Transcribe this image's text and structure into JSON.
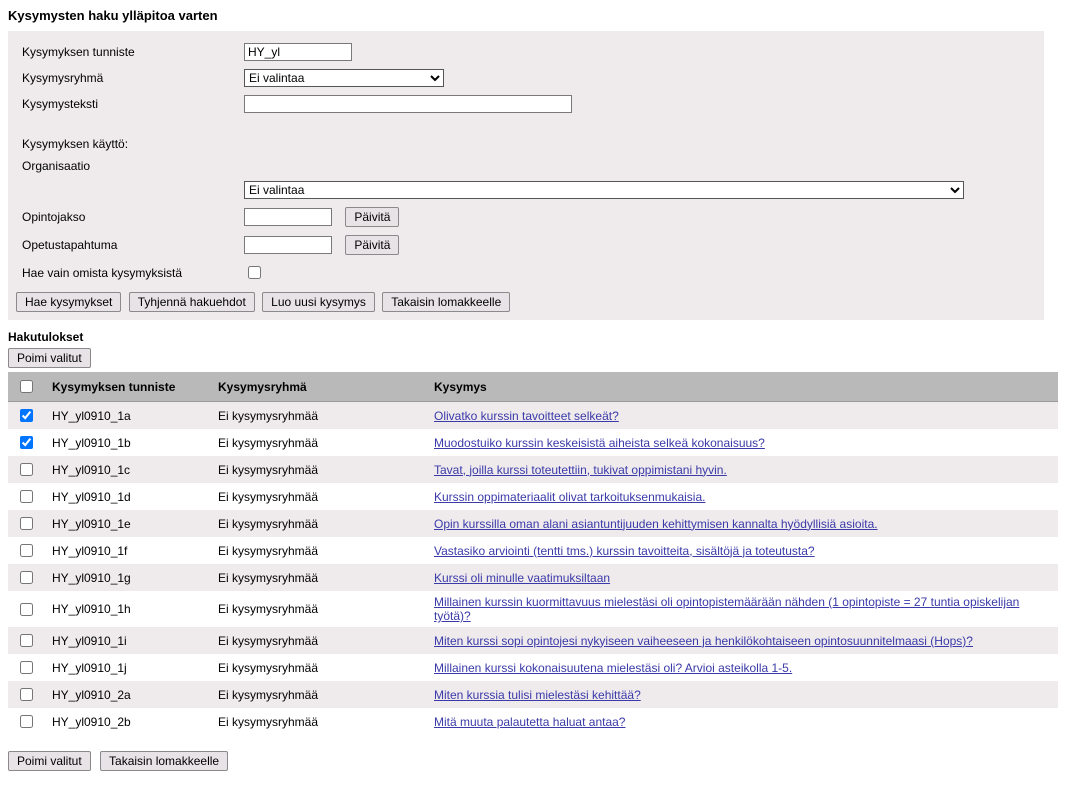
{
  "titles": {
    "page": "Kysymysten haku ylläpitoa varten",
    "results": "Hakutulokset"
  },
  "form": {
    "labels": {
      "id": "Kysymyksen tunniste",
      "group": "Kysymysryhmä",
      "text": "Kysymysteksti",
      "usage": "Kysymyksen käyttö:",
      "org": "Organisaatio",
      "course": "Opintojakso",
      "event": "Opetustapahtuma",
      "owncb": "Hae vain omista kysymyksistä"
    },
    "values": {
      "id": "HY_yl",
      "group": "Ei valintaa",
      "text": "",
      "org": "Ei valintaa",
      "course": "",
      "event": ""
    },
    "buttons": {
      "update": "Päivitä",
      "search": "Hae kysymykset",
      "clear": "Tyhjennä hakuehdot",
      "create": "Luo uusi kysymys",
      "backform": "Takaisin lomakkeelle",
      "pick": "Poimi valitut"
    }
  },
  "headers": {
    "id": "Kysymyksen tunniste",
    "group": "Kysymysryhmä",
    "question": "Kysymys"
  },
  "rows": [
    {
      "checked": true,
      "id": "HY_yl0910_1a",
      "group": "Ei kysymysryhmää",
      "question": "Olivatko kurssin tavoitteet selkeät?"
    },
    {
      "checked": true,
      "id": "HY_yl0910_1b",
      "group": "Ei kysymysryhmää",
      "question": "Muodostuiko kurssin keskeisistä aiheista selkeä kokonaisuus?"
    },
    {
      "checked": false,
      "id": "HY_yl0910_1c",
      "group": "Ei kysymysryhmää",
      "question": "Tavat, joilla kurssi toteutettiin, tukivat oppimistani hyvin."
    },
    {
      "checked": false,
      "id": "HY_yl0910_1d",
      "group": "Ei kysymysryhmää",
      "question": "Kurssin oppimateriaalit olivat tarkoituksenmukaisia."
    },
    {
      "checked": false,
      "id": "HY_yl0910_1e",
      "group": "Ei kysymysryhmää",
      "question": "Opin kurssilla oman alani asiantuntijuuden kehittymisen kannalta hyödyllisiä asioita."
    },
    {
      "checked": false,
      "id": "HY_yl0910_1f",
      "group": "Ei kysymysryhmää",
      "question": "Vastasiko arviointi (tentti tms.) kurssin tavoitteita, sisältöjä ja toteutusta?"
    },
    {
      "checked": false,
      "id": "HY_yl0910_1g",
      "group": "Ei kysymysryhmää",
      "question": "Kurssi oli minulle vaatimuksiltaan"
    },
    {
      "checked": false,
      "id": "HY_yl0910_1h",
      "group": "Ei kysymysryhmää",
      "question": "Millainen kurssin kuormittavuus mielestäsi oli opintopistemäärään nähden (1 opintopiste = 27 tuntia opiskelijan työtä)?"
    },
    {
      "checked": false,
      "id": "HY_yl0910_1i",
      "group": "Ei kysymysryhmää",
      "question": "Miten kurssi sopi opintojesi nykyiseen vaiheeseen ja henkilökohtaiseen opintosuunnitelmaasi (Hops)?"
    },
    {
      "checked": false,
      "id": "HY_yl0910_1j",
      "group": "Ei kysymysryhmää",
      "question": "Millainen kurssi kokonaisuutena mielestäsi oli? Arvioi asteikolla 1-5."
    },
    {
      "checked": false,
      "id": "HY_yl0910_2a",
      "group": "Ei kysymysryhmää",
      "question": "Miten kurssia tulisi mielestäsi kehittää?"
    },
    {
      "checked": false,
      "id": "HY_yl0910_2b",
      "group": "Ei kysymysryhmää",
      "question": "Mitä muuta palautetta haluat antaa?"
    }
  ]
}
